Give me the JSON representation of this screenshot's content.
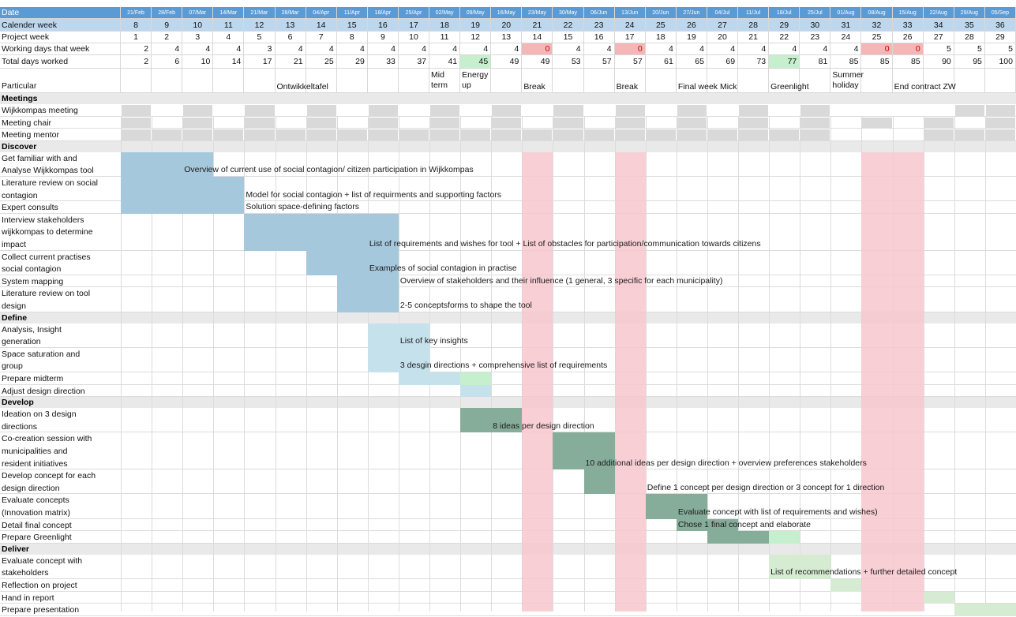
{
  "rows": {
    "date_label": "Date",
    "week_label": "Calender week",
    "project_label": "Project week",
    "working_label": "Working days that week",
    "total_label": "Total days worked",
    "particular_label": "Particular"
  },
  "dates": [
    "21/Feb",
    "28/Feb",
    "07/Mar",
    "14/Mar",
    "21/Mar",
    "28/Mar",
    "04/Apr",
    "11/Apr",
    "18/Apr",
    "25/Apr",
    "02/May",
    "09/May",
    "16/May",
    "23/May",
    "30/May",
    "06/Jun",
    "13/Jun",
    "20/Jun",
    "27/Jun",
    "04/Jul",
    "11/Jul",
    "18/Jul",
    "25/Jul",
    "01/Aug",
    "08/Aug",
    "15/Aug",
    "22/Aug",
    "29/Aug",
    "05/Sep"
  ],
  "calendar_weeks": [
    "8",
    "9",
    "10",
    "11",
    "12",
    "13",
    "14",
    "15",
    "16",
    "17",
    "18",
    "19",
    "20",
    "21",
    "22",
    "23",
    "24",
    "25",
    "26",
    "27",
    "28",
    "29",
    "30",
    "31",
    "32",
    "33",
    "34",
    "35",
    "36"
  ],
  "project_weeks": [
    "1",
    "2",
    "3",
    "4",
    "5",
    "6",
    "7",
    "8",
    "9",
    "10",
    "11",
    "12",
    "13",
    "14",
    "15",
    "16",
    "17",
    "18",
    "19",
    "20",
    "21",
    "22",
    "23",
    "24",
    "25",
    "26",
    "27",
    "28",
    "29"
  ],
  "working_days": [
    "2",
    "4",
    "4",
    "4",
    "3",
    "4",
    "4",
    "4",
    "4",
    "4",
    "4",
    "4",
    "4",
    "0",
    "4",
    "4",
    "0",
    "4",
    "4",
    "4",
    "4",
    "4",
    "4",
    "4",
    "0",
    "0",
    "5",
    "5",
    "5"
  ],
  "total_days": [
    "2",
    "6",
    "10",
    "14",
    "17",
    "21",
    "25",
    "29",
    "33",
    "37",
    "41",
    "45",
    "49",
    "49",
    "53",
    "57",
    "57",
    "61",
    "65",
    "69",
    "73",
    "77",
    "81",
    "85",
    "85",
    "85",
    "90",
    "95",
    "100"
  ],
  "particulars": [
    {
      "col": 5,
      "text": "Ontwikkeltafel"
    },
    {
      "col": 10,
      "text": "Mid\nterm"
    },
    {
      "col": 11,
      "text": "Energy\nup"
    },
    {
      "col": 13,
      "text": "Break"
    },
    {
      "col": 16,
      "text": "Break"
    },
    {
      "col": 18,
      "text": "Final week Mick"
    },
    {
      "col": 21,
      "text": "Greenlight"
    },
    {
      "col": 23,
      "text": "Summer\nholiday"
    },
    {
      "col": 25,
      "text": "End contract ZW"
    }
  ],
  "sections": {
    "meetings": "Meetings",
    "discover": "Discover",
    "define": "Define",
    "develop": "Develop",
    "deliver": "Deliver"
  },
  "meetings": [
    {
      "label": "Wijkkompas meeting"
    },
    {
      "label": "Meeting chair"
    },
    {
      "label": "Meeting mentor"
    }
  ],
  "tasks": {
    "discover": [
      {
        "label": "Get familiar with and\nAnalyse  Wijkkompas tool"
      },
      {
        "label": "Literature review on social\ncontagion"
      },
      {
        "label": "Expert consults"
      },
      {
        "label": "Interview stakeholders\nwijkkompas to determine\nimpact"
      },
      {
        "label": "Collect current practises\nsocial contagion"
      },
      {
        "label": "System mapping"
      },
      {
        "label": "Literature review on tool\ndesign"
      }
    ],
    "define": [
      {
        "label": "Analysis, Insight\ngeneration"
      },
      {
        "label": " Space saturation and\ngroup"
      },
      {
        "label": "Prepare midterm"
      },
      {
        "label": "Adjust design direction"
      }
    ],
    "develop": [
      {
        "label": "Ideation on 3 design\ndirections"
      },
      {
        "label": "Co-creation session with\nmunicipalities and\nresident initiatives"
      },
      {
        "label": "Develop concept for each\ndesign direction"
      },
      {
        "label": "Evaluate concepts\n(Innovation matrix)"
      },
      {
        "label": "Detail final concept"
      },
      {
        "label": "Prepare Greenlight"
      }
    ],
    "deliver": [
      {
        "label": "Evaluate concept with\nstakeholders"
      },
      {
        "label": "Reflection on project"
      },
      {
        "label": "Hand in report"
      },
      {
        "label": "Prepare presentation"
      }
    ]
  },
  "deliverables": [
    "Overview of current use of social contagion/ citizen participation in Wijkkompas",
    "Model for social contagion + list of requirments and supporting factors",
    "Solution space-defining factors",
    "List of requirements and wishes for tool + List of obstacles for participation/communication towards citizens",
    "Examples of social contagion in practise",
    "Overview of stakeholders and their influence (1 general, 3 specific for each municipality)",
    "2-5 conceptsforms to shape the tool",
    "List of key insights",
    "3 desgin directions + comprehensive list of requirements",
    "8 ideas per design direction",
    "10 additional ideas per design direction + overview preferences stakeholders",
    "Define 1 concept per design direction or 3 concept for 1 direction",
    "Evaluate concept with list of requirements and wishes)",
    "Chose 1 final concept and elaborate",
    "List of recommendations + further detailed concept"
  ],
  "colors": {
    "header_blue": "#5b9bd5",
    "week_band": "#bdd7ee",
    "discover_bar": "#a5c8dc",
    "define_bar": "#c5e2ec",
    "develop_bar": "#86ad9a",
    "deliver_bar": "#d6ecd2",
    "green_marker": "#c6efce",
    "break_red": "#f8c7cf",
    "zero_red": "#f4b6b6",
    "meeting_grey": "#d9d9d9",
    "section_grey": "#e9e9e9"
  }
}
